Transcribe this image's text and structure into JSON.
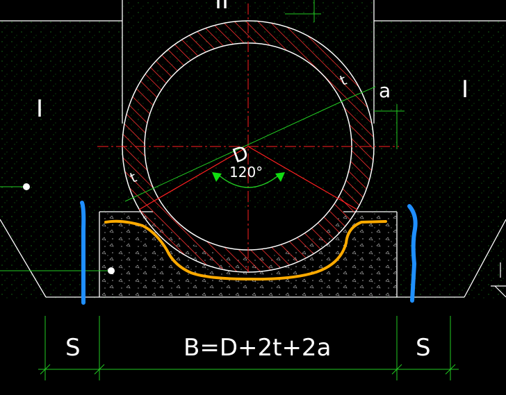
{
  "drawing": {
    "layer_top_label": "II",
    "zone_label_left": "I",
    "zone_label_right": "I",
    "pipe_diameter_label": "D",
    "wall_thickness_label_right": "t",
    "wall_thickness_label_left": "t",
    "clearance_label": "a",
    "bedding_angle_label": "120°",
    "side_width_label_left": "S",
    "side_width_label_right": "S",
    "trench_width_formula": "B=D+2t+2a"
  },
  "colors": {
    "background": "#000000",
    "line_white": "#ffffff",
    "centerline_red": "#ff2020",
    "hatch_red": "#ff3030",
    "dimension_green": "#22cc22",
    "arrow_green": "#11dd11",
    "annotation_blue": "#1f8fff",
    "annotation_orange": "#ffaa00"
  },
  "icons": {
    "origin_marker": "dot-icon",
    "ground_symbol": "ground-hatch-icon"
  }
}
